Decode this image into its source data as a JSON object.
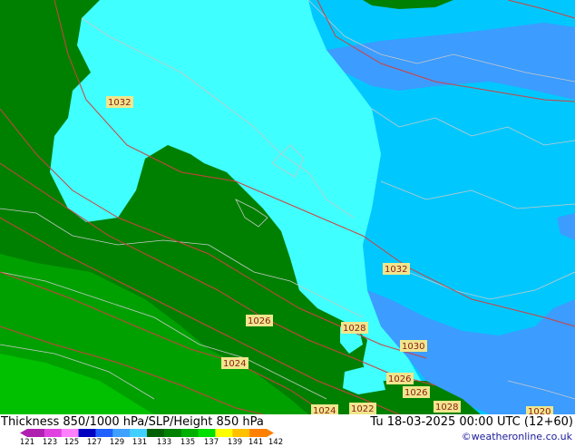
{
  "map": {
    "pressure_labels": [
      "1032",
      "1032",
      "1026",
      "1028",
      "1024",
      "1030",
      "1026",
      "1026",
      "1028",
      "1024",
      "1022",
      "1020"
    ],
    "colors": {
      "thickness_131": "#008000",
      "thickness_133": "#00a000",
      "thickness_129": "#00c8ff",
      "thickness_127": "#40ffff",
      "thickness_125": "#3c9cff",
      "isobar": "#d04040",
      "coast": "#c8c8c8"
    }
  },
  "footer": {
    "title": "Thickness 850/1000 hPa/SLP/Height 850 hPa",
    "time": "Tu 18-03-2025 00:00 UTC (12+60)",
    "credit": "©weatheronline.co.uk",
    "legend_ticks": [
      "121",
      "123",
      "125",
      "127",
      "129",
      "131",
      "133",
      "135",
      "137",
      "139",
      "141",
      "142"
    ],
    "legend_colors": [
      "#b020b0",
      "#e040e0",
      "#ff80ff",
      "#0000c0",
      "#2060ff",
      "#40a0ff",
      "#40d0ff",
      "#006000",
      "#008000",
      "#00b000",
      "#00e000",
      "#ffff00",
      "#ffc000",
      "#ff8000"
    ]
  }
}
